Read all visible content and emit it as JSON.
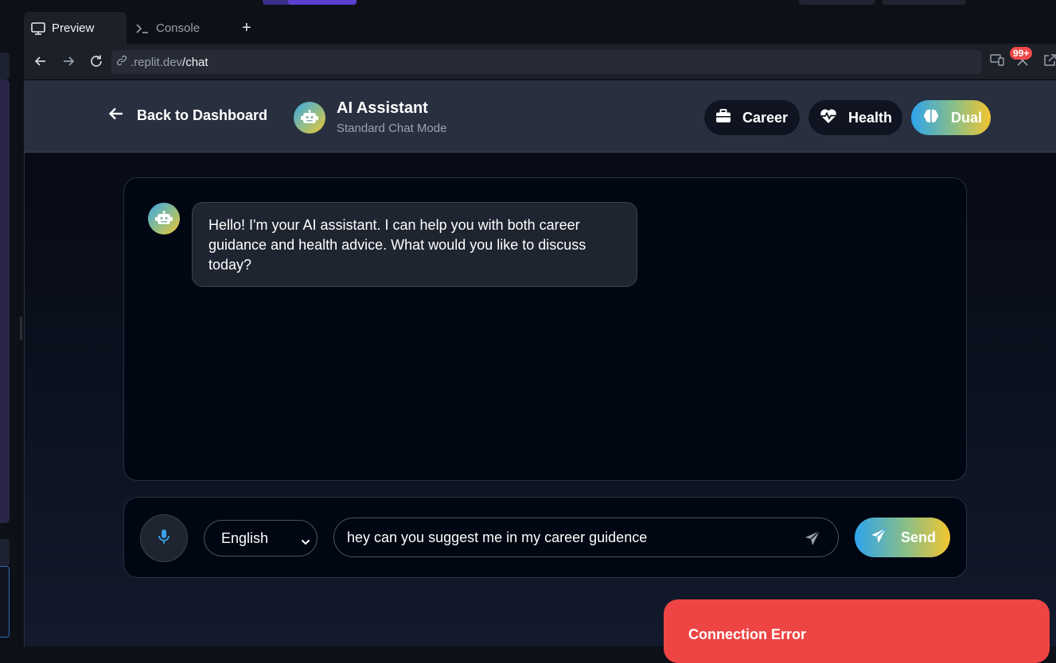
{
  "browser": {
    "tabs": [
      {
        "label": "Preview",
        "icon": "monitor-icon",
        "active": true
      },
      {
        "label": "Console",
        "icon": "terminal-icon",
        "active": false
      }
    ],
    "add_tab_label": "+",
    "url_domain": ".replit.dev",
    "url_path": "/chat",
    "notification_badge": "99+"
  },
  "header": {
    "back_label": "Back to Dashboard",
    "title": "AI Assistant",
    "subtitle": "Standard Chat Mode",
    "modes": [
      {
        "label": "Career",
        "icon": "briefcase-icon"
      },
      {
        "label": "Health",
        "icon": "heart-pulse-icon"
      },
      {
        "label": "Dual",
        "icon": "brain-icon",
        "active": true
      }
    ]
  },
  "chat": {
    "messages": [
      {
        "sender": "assistant",
        "text": "Hello! I'm your AI assistant. I can help you with both career guidance and health advice. What would you like to discuss today?"
      }
    ]
  },
  "composer": {
    "language": "English",
    "input_value": "hey can you suggest me in my career guidence",
    "send_label": "Send"
  },
  "toast": {
    "title": "Connection Error"
  },
  "colors": {
    "accent_gradient_start": "#2ea3ec",
    "accent_gradient_end": "#f3c52f",
    "error": "#ef4444",
    "header_bg": "#283040",
    "panel_bg": "#000612"
  }
}
